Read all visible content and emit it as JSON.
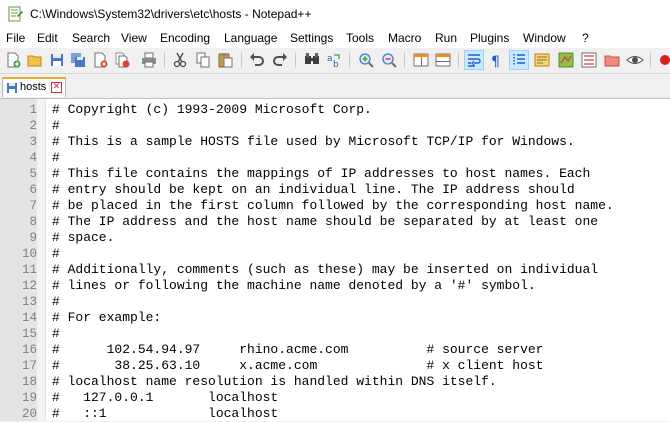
{
  "window": {
    "title": "C:\\Windows\\System32\\drivers\\etc\\hosts - Notepad++"
  },
  "menu": [
    "File",
    "Edit",
    "Search",
    "View",
    "Encoding",
    "Language",
    "Settings",
    "Tools",
    "Macro",
    "Run",
    "Plugins",
    "Window",
    "?"
  ],
  "tabs": [
    {
      "label": "hosts"
    }
  ],
  "editor": {
    "lines": [
      "# Copyright (c) 1993-2009 Microsoft Corp.",
      "#",
      "# This is a sample HOSTS file used by Microsoft TCP/IP for Windows.",
      "#",
      "# This file contains the mappings of IP addresses to host names. Each",
      "# entry should be kept on an individual line. The IP address should",
      "# be placed in the first column followed by the corresponding host name.",
      "# The IP address and the host name should be separated by at least one",
      "# space.",
      "#",
      "# Additionally, comments (such as these) may be inserted on individual",
      "# lines or following the machine name denoted by a '#' symbol.",
      "#",
      "# For example:",
      "#",
      "#      102.54.94.97     rhino.acme.com          # source server",
      "#       38.25.63.10     x.acme.com              # x client host",
      "# localhost name resolution is handled within DNS itself.",
      "#   127.0.0.1       localhost",
      "#   ::1             localhost"
    ]
  }
}
